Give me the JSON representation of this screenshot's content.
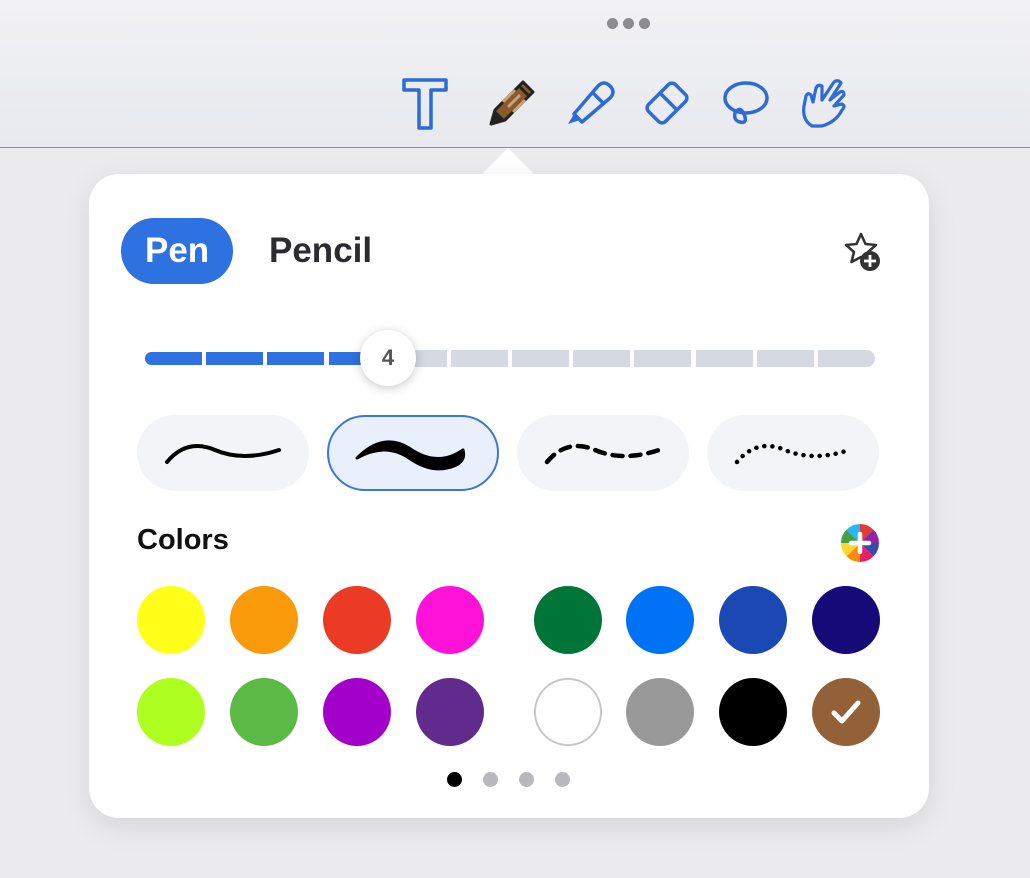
{
  "toolbar": {
    "tools": [
      {
        "name": "text-tool",
        "icon": "text-icon",
        "selected": false
      },
      {
        "name": "pen-tool",
        "icon": "pen-icon",
        "selected": true
      },
      {
        "name": "highlighter-tool",
        "icon": "highlighter-icon",
        "selected": false
      },
      {
        "name": "eraser-tool",
        "icon": "eraser-icon",
        "selected": false
      },
      {
        "name": "lasso-tool",
        "icon": "lasso-icon",
        "selected": false
      },
      {
        "name": "touch-tool",
        "icon": "hand-pointer-icon",
        "selected": false
      }
    ],
    "more_icon": "more-dots-icon"
  },
  "panel": {
    "tabs": [
      {
        "label": "Pen",
        "active": true
      },
      {
        "label": "Pencil",
        "active": false
      }
    ],
    "favorite_icon": "star-add-icon",
    "thickness": {
      "value": "4",
      "segments": 12,
      "filled_segments": 4
    },
    "stroke_styles": [
      {
        "name": "thin-line",
        "selected": false
      },
      {
        "name": "thick-variable-line",
        "selected": true
      },
      {
        "name": "dashed-line",
        "selected": false
      },
      {
        "name": "dotted-line",
        "selected": false
      }
    ],
    "colors_title": "Colors",
    "add_color_icon": "color-wheel-add-icon",
    "colors": [
      [
        "#ffff1a",
        "#f89a0a",
        "#ec3b24",
        "#ff12d8",
        "#007538",
        "#0072f5",
        "#1b49b3",
        "#160a78"
      ],
      [
        "#aefe1f",
        "#5bba45",
        "#a300c9",
        "#602b8c",
        "#ffffff",
        "#999999",
        "#000000",
        "#936137"
      ]
    ],
    "selected_color": "#936137",
    "pages": {
      "count": 4,
      "current": 0
    }
  }
}
